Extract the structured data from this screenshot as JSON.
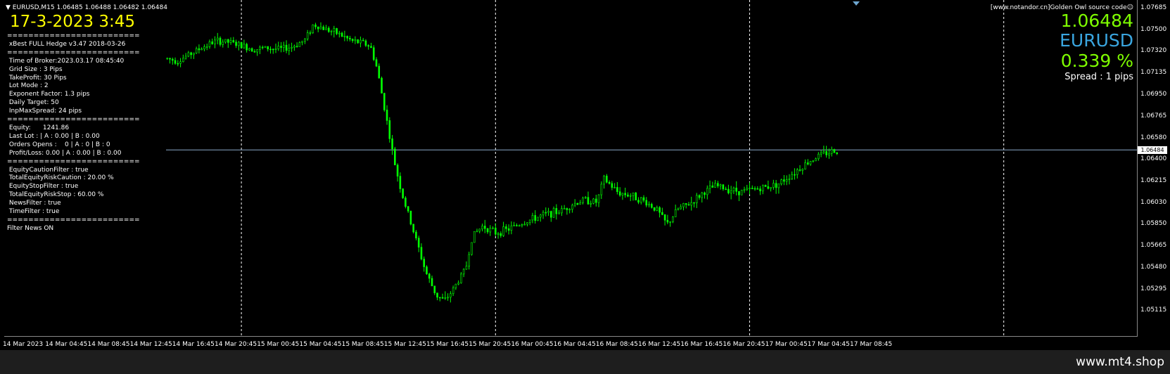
{
  "header": {
    "symbol_line": "EURUSD,M15  1.06485 1.06488 1.06482 1.06484",
    "broker_time": "17-3-2023 3:45"
  },
  "info_panel": [
    "=========================",
    " xBest FULL Hedge v3.47 2018-03-26",
    "=========================",
    " Time of Broker:2023.03.17 08:45:40",
    " Grid Size : 3 Pips",
    " TakeProfit: 30 Pips",
    " Lot Mode : 2",
    " Exponent Factor: 1.3 pips",
    " Daily Target: 50",
    " InpMaxSpread: 24 pips",
    "=========================",
    " Equity:      1241.86",
    " Last Lot : | A : 0.00 | B : 0.00",
    " Orders Opens :    0 | A : 0 | B : 0",
    " Profit/Loss: 0.00 | A : 0.00 | B : 0.00",
    "=========================",
    " EquityCautionFilter : true",
    " TotalEquityRiskCaution : 20.00 %",
    " EquityStopFilter : true",
    " TotalEquityRiskStop : 60.00 %",
    " NewsFilter : true",
    " TimeFilter : true",
    "=========================",
    "Filter News ON"
  ],
  "right_panel": {
    "source": "[www.notandor.cn]Golden Owl source code☺",
    "price": "1.06484",
    "symbol": "EURUSD",
    "percent": "0.339 %",
    "spread": "Spread : 1 pips"
  },
  "colors": {
    "candle": "#00ff00",
    "price_line": "#8aa8c8",
    "grid_line": "#ffffff"
  },
  "chart_data": {
    "type": "candlestick",
    "symbol": "EURUSD",
    "timeframe": "M15",
    "current_price": 1.06484,
    "current_price_label": "1.06484",
    "y_ticks": [
      "1.07685",
      "1.07500",
      "1.07320",
      "1.07135",
      "1.06950",
      "1.06765",
      "1.06580",
      "1.06400",
      "1.06215",
      "1.06030",
      "1.05850",
      "1.05665",
      "1.05480",
      "1.05295",
      "1.05115"
    ],
    "ylim": [
      1.0507,
      1.0771
    ],
    "x_ticks": [
      "14 Mar 2023",
      "14 Mar 04:45",
      "14 Mar 08:45",
      "14 Mar 12:45",
      "14 Mar 16:45",
      "14 Mar 20:45",
      "15 Mar 00:45",
      "15 Mar 04:45",
      "15 Mar 08:45",
      "15 Mar 12:45",
      "15 Mar 16:45",
      "15 Mar 20:45",
      "16 Mar 00:45",
      "16 Mar 04:45",
      "16 Mar 08:45",
      "16 Mar 12:45",
      "16 Mar 16:45",
      "16 Mar 20:45",
      "17 Mar 00:45",
      "17 Mar 04:45",
      "17 Mar 08:45"
    ],
    "day_separators_at_tick_index": [
      5.5,
      11.5,
      17.5,
      23.5
    ],
    "close_path": [
      [
        3.75,
        1.0726
      ],
      [
        4.0,
        1.0724
      ],
      [
        4.3,
        1.073
      ],
      [
        4.6,
        1.0736
      ],
      [
        4.9,
        1.0741
      ],
      [
        5.2,
        1.074
      ],
      [
        5.5,
        1.0737
      ],
      [
        5.8,
        1.0734
      ],
      [
        6.1,
        1.0735
      ],
      [
        6.4,
        1.0734
      ],
      [
        6.7,
        1.0736
      ],
      [
        7.0,
        1.0742
      ],
      [
        7.2,
        1.0755
      ],
      [
        7.5,
        1.0751
      ],
      [
        7.8,
        1.0747
      ],
      [
        8.1,
        1.0741
      ],
      [
        8.4,
        1.0739
      ],
      [
        8.55,
        1.0736
      ],
      [
        8.7,
        1.0718
      ],
      [
        8.9,
        1.068
      ],
      [
        9.0,
        1.066
      ],
      [
        9.1,
        1.064
      ],
      [
        9.3,
        1.061
      ],
      [
        9.6,
        1.0575
      ],
      [
        9.85,
        1.0545
      ],
      [
        10.1,
        1.0525
      ],
      [
        10.3,
        1.052
      ],
      [
        10.5,
        1.053
      ],
      [
        10.8,
        1.0548
      ],
      [
        10.95,
        1.0575
      ],
      [
        11.2,
        1.0584
      ],
      [
        11.5,
        1.0578
      ],
      [
        11.8,
        1.0581
      ],
      [
        12.1,
        1.0586
      ],
      [
        12.4,
        1.059
      ],
      [
        12.7,
        1.0594
      ],
      [
        13.0,
        1.0596
      ],
      [
        13.3,
        1.0602
      ],
      [
        13.6,
        1.0606
      ],
      [
        13.9,
        1.0604
      ],
      [
        14.05,
        1.0624
      ],
      [
        14.2,
        1.0619
      ],
      [
        14.4,
        1.0612
      ],
      [
        14.7,
        1.061
      ],
      [
        15.0,
        1.0605
      ],
      [
        15.3,
        1.0598
      ],
      [
        15.55,
        1.0585
      ],
      [
        15.8,
        1.0598
      ],
      [
        16.1,
        1.0603
      ],
      [
        16.4,
        1.0612
      ],
      [
        16.7,
        1.0618
      ],
      [
        17.0,
        1.0615
      ],
      [
        17.3,
        1.0613
      ],
      [
        17.6,
        1.0615
      ],
      [
        17.9,
        1.0617
      ],
      [
        18.2,
        1.062
      ],
      [
        18.5,
        1.0628
      ],
      [
        18.8,
        1.0636
      ],
      [
        19.1,
        1.0643
      ],
      [
        19.4,
        1.0647
      ],
      [
        19.6,
        1.0648
      ]
    ]
  },
  "footer": {
    "site": "www.mt4.shop"
  }
}
